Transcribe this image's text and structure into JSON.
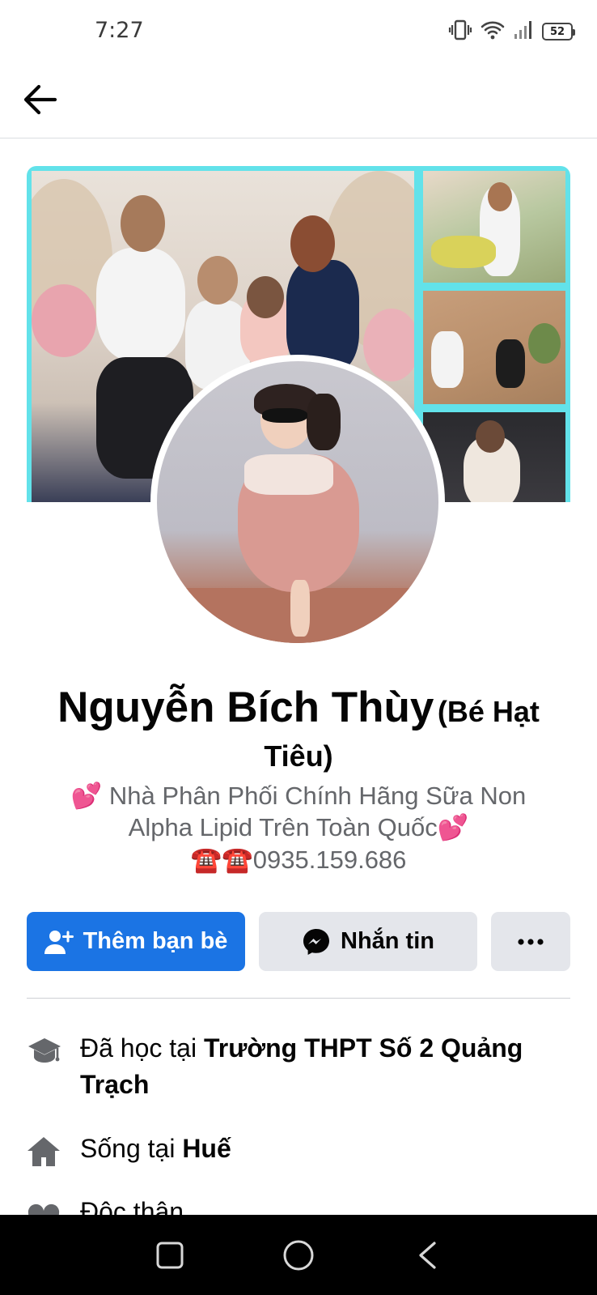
{
  "status_bar": {
    "time": "7:27",
    "battery": "52",
    "icons": [
      "vibrate-icon",
      "wifi-icon",
      "signal-icon",
      "battery-icon"
    ]
  },
  "header": {
    "back_icon": "arrow-left-icon"
  },
  "profile": {
    "name": "Nguyễn Bích Thùy",
    "alternate_name": "(Bé Hạt Tiêu)",
    "bio_line1": "Nhà Phân Phối Chính Hãng Sữa Non",
    "bio_line2": "Alpha Lipid Trên Toàn Quốc",
    "bio_phone": "0935.159.686",
    "bio_heart_emoji": "💕",
    "bio_phone_emoji": "☎️☎️"
  },
  "actions": {
    "add_friend_label": "Thêm bạn bè",
    "message_label": "Nhắn tin",
    "more_label": "..."
  },
  "details": {
    "education_prefix": "Đã học tại ",
    "education_school": "Trường THPT Số 2 Quảng Trạch",
    "lives_prefix": "Sống tại ",
    "lives_city": "Huế",
    "relationship": "Độc thân"
  },
  "colors": {
    "primary": "#1b74e4",
    "secondary_button": "#e4e6eb",
    "cover_frame": "#62e2ea",
    "muted_text": "#65676b"
  }
}
